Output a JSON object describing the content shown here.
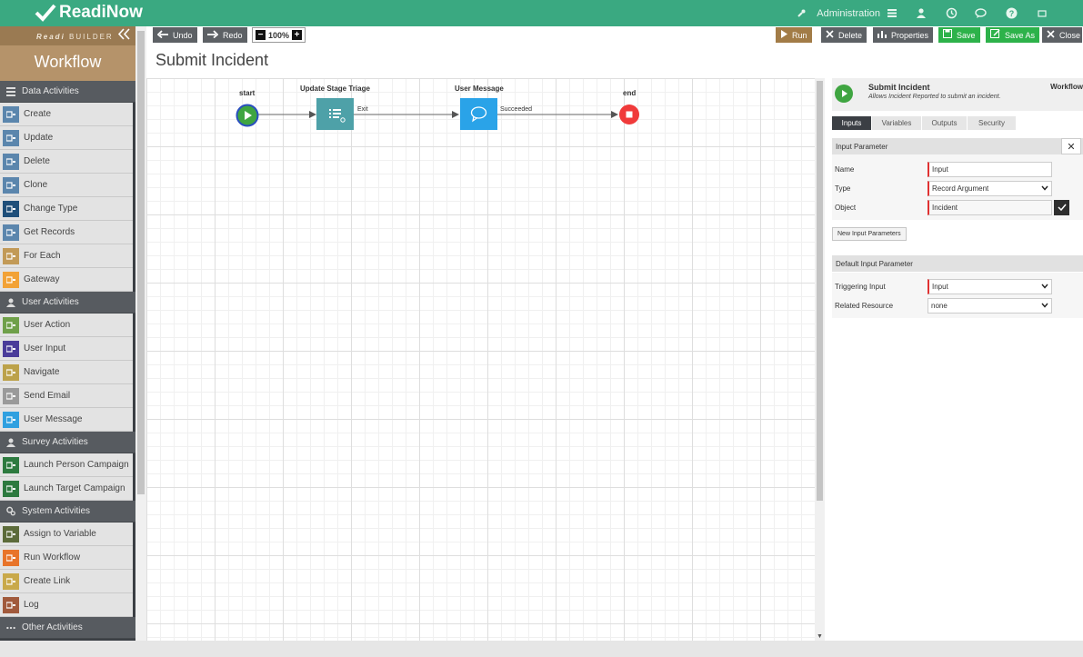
{
  "app": {
    "brand": "ReadiNow"
  },
  "topbar": {
    "admin_label": "Administration"
  },
  "sidebar": {
    "brand_prefix": "Readi",
    "brand_suffix": "BUILDER",
    "title": "Workflow",
    "categories": [
      {
        "label": "Data Activities",
        "items": [
          {
            "label": "Create",
            "icon": "create-icon",
            "color": "#5b86ad"
          },
          {
            "label": "Update",
            "icon": "update-icon",
            "color": "#5b86ad"
          },
          {
            "label": "Delete",
            "icon": "delete-icon",
            "color": "#5b86ad"
          },
          {
            "label": "Clone",
            "icon": "clone-icon",
            "color": "#5b86ad"
          },
          {
            "label": "Change Type",
            "icon": "change-type-icon",
            "color": "#1f4f7a"
          },
          {
            "label": "Get Records",
            "icon": "get-records-icon",
            "color": "#5b86ad"
          },
          {
            "label": "For Each",
            "icon": "for-each-icon",
            "color": "#c29a57"
          },
          {
            "label": "Gateway",
            "icon": "gateway-icon",
            "color": "#f2a236"
          }
        ]
      },
      {
        "label": "User Activities",
        "items": [
          {
            "label": "User Action",
            "icon": "user-action-icon",
            "color": "#6fa049"
          },
          {
            "label": "User Input",
            "icon": "user-input-icon",
            "color": "#4a3c9a"
          },
          {
            "label": "Navigate",
            "icon": "navigate-icon",
            "color": "#bca24a"
          },
          {
            "label": "Send Email",
            "icon": "send-email-icon",
            "color": "#9a9a9a"
          },
          {
            "label": "User Message",
            "icon": "user-message-icon",
            "color": "#2fa0e0"
          }
        ]
      },
      {
        "label": "Survey Activities",
        "items": [
          {
            "label": "Launch Person Campaign",
            "icon": "launch-person-campaign-icon",
            "color": "#2d7a3f"
          },
          {
            "label": "Launch Target Campaign",
            "icon": "launch-target-campaign-icon",
            "color": "#2d7a3f"
          }
        ]
      },
      {
        "label": "System Activities",
        "items": [
          {
            "label": "Assign to Variable",
            "icon": "assign-variable-icon",
            "color": "#5c6b3a"
          },
          {
            "label": "Run Workflow",
            "icon": "run-workflow-icon",
            "color": "#e8742a"
          },
          {
            "label": "Create Link",
            "icon": "create-link-icon",
            "color": "#c9a94a"
          },
          {
            "label": "Log",
            "icon": "log-icon",
            "color": "#a15a3c"
          }
        ]
      },
      {
        "label": "Other Activities",
        "items": []
      }
    ]
  },
  "toolbar": {
    "undo": "Undo",
    "redo": "Redo",
    "zoom": "100%",
    "run": "Run",
    "delete": "Delete",
    "properties": "Properties",
    "save": "Save",
    "save_as": "Save As",
    "close": "Close"
  },
  "page": {
    "title": "Submit Incident"
  },
  "diagram": {
    "start_label": "start",
    "stage_label": "Update Stage Triage",
    "message_label": "User Message",
    "end_label": "end",
    "edge_exit": "Exit",
    "edge_succeeded": "Succeeded"
  },
  "panel": {
    "title": "Submit Incident",
    "description": "Allows Incident Reported to submit an incident.",
    "type": "Workflow",
    "tabs": [
      "Inputs",
      "Variables",
      "Outputs",
      "Security"
    ],
    "input_section": "Input Parameter",
    "name_label": "Name",
    "name_value": "Input",
    "type_label": "Type",
    "type_value": "Record Argument",
    "object_label": "Object",
    "object_value": "Incident",
    "new_button": "New Input Parameters",
    "default_section": "Default Input Parameter",
    "triggering_label": "Triggering Input",
    "triggering_value": "Input",
    "related_label": "Related Resource",
    "related_value": "none"
  }
}
